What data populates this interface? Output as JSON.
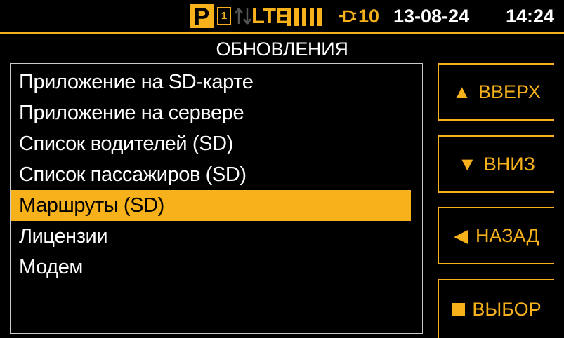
{
  "status": {
    "mode_badge": "P",
    "sim_slot": "1",
    "network": "LTE",
    "signal_bars": 5,
    "power_count": "10",
    "date": "13-08-24",
    "time": "14:24",
    "accent_color": "#F7B21B"
  },
  "title": "ОБНОВЛЕНИЯ",
  "menu": {
    "selected_index": 4,
    "items": [
      "Приложение на SD-карте",
      "Приложение на сервере",
      "Список водителей (SD)",
      "Список пассажиров (SD)",
      "Маршруты (SD)",
      "Лицензии",
      "Модем"
    ]
  },
  "buttons": {
    "up": {
      "glyph": "▲",
      "label": "ВВЕРХ",
      "icon": "triangle-up-icon"
    },
    "down": {
      "glyph": "▼",
      "label": "ВНИЗ",
      "icon": "triangle-down-icon"
    },
    "back": {
      "glyph": "◀",
      "label": "НАЗАД",
      "icon": "triangle-left-icon"
    },
    "select": {
      "label": "ВЫБОР",
      "icon": "square-icon"
    }
  }
}
